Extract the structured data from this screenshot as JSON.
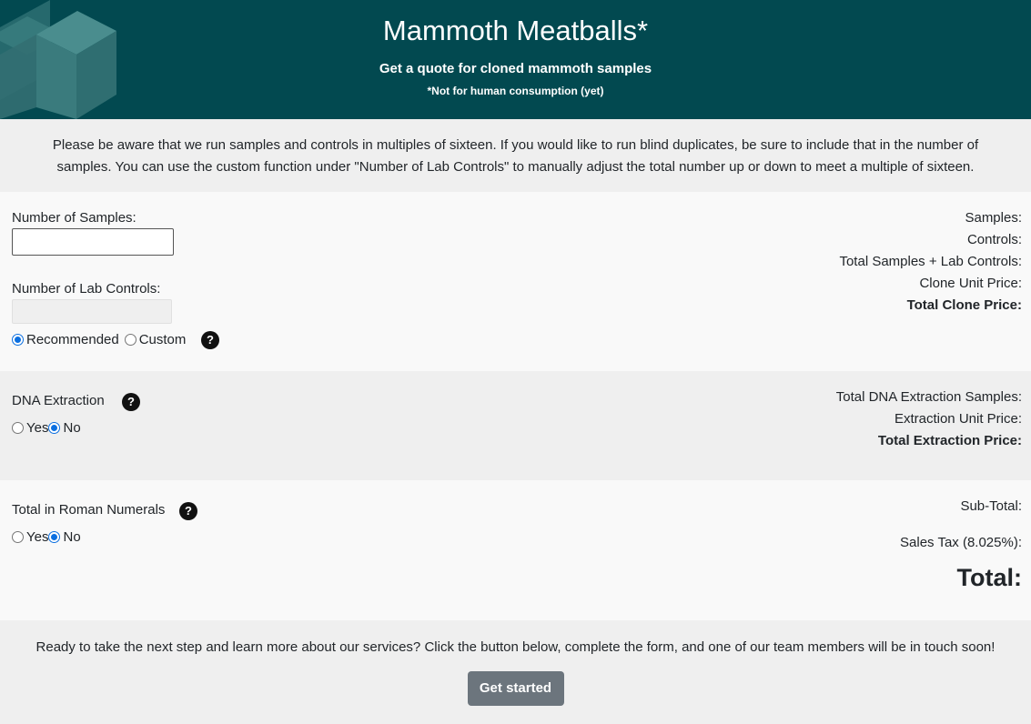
{
  "header": {
    "title": "Mammoth Meatballs*",
    "subtitle": "Get a quote for cloned mammoth samples",
    "note": "*Not for human consumption (yet)"
  },
  "notice": "Please be aware that we run samples and controls in multiples of sixteen. If you would like to run blind duplicates, be sure to include that in the number of samples. You can use the custom function under \"Number of Lab Controls\" to manually adjust the total number up or down to meet a multiple of sixteen.",
  "samples": {
    "label": "Number of Samples:",
    "value": ""
  },
  "controls": {
    "label": "Number of Lab Controls:",
    "value": "",
    "options": [
      "Recommended",
      "Custom"
    ],
    "selected": "Recommended",
    "help": "?"
  },
  "summary1": {
    "samples": "Samples:",
    "controls": "Controls:",
    "total_samples_controls": "Total Samples + Lab Controls:",
    "clone_unit_price": "Clone Unit Price:",
    "total_clone_price": "Total Clone Price:"
  },
  "dna": {
    "label": "DNA Extraction",
    "help": "?",
    "options": [
      "Yes",
      "No"
    ],
    "selected": "No"
  },
  "summary2": {
    "total_dna_samples": "Total DNA Extraction Samples:",
    "extraction_unit_price": "Extraction Unit Price:",
    "total_extraction_price": "Total Extraction Price:"
  },
  "roman": {
    "label": "Total in Roman Numerals",
    "help": "?",
    "options": [
      "Yes",
      "No"
    ],
    "selected": "No"
  },
  "summary3": {
    "subtotal": "Sub-Total:",
    "sales_tax": "Sales Tax (8.025%):",
    "total": "Total:"
  },
  "footer": {
    "text": "Ready to take the next step and learn more about our services? Click the button below, complete the form, and one of our team members will be in touch soon!",
    "button": "Get started"
  },
  "colors": {
    "header_bg": "#024950",
    "button_bg": "#6c757d",
    "radio_accent": "#0b6fe0"
  }
}
